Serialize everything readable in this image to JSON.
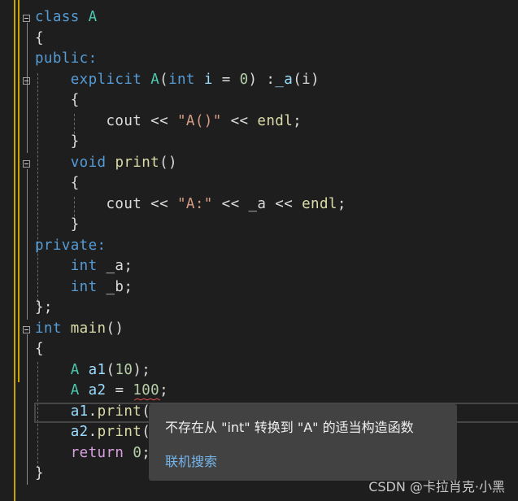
{
  "editor": {
    "lines": [
      [
        [
          "class ",
          "kw"
        ],
        [
          "A",
          "ty"
        ]
      ],
      [
        [
          "{",
          "tx"
        ]
      ],
      [
        [
          "public:",
          "kw"
        ]
      ],
      [
        [
          "    ",
          "tx"
        ],
        [
          "explicit ",
          "kw"
        ],
        [
          "A",
          "ty"
        ],
        [
          "(",
          "tx"
        ],
        [
          "int ",
          "kw"
        ],
        [
          "i ",
          "va"
        ],
        [
          "= ",
          "tx"
        ],
        [
          "0",
          "nu"
        ],
        [
          ") :",
          "tx"
        ],
        [
          "_a",
          "va"
        ],
        [
          "(i)",
          "tx"
        ]
      ],
      [
        [
          "    {",
          "tx"
        ]
      ],
      [
        [
          "        cout << ",
          "tx"
        ],
        [
          "\"A()\"",
          "st"
        ],
        [
          " << ",
          "tx"
        ],
        [
          "endl",
          "fn"
        ],
        [
          ";",
          "tx"
        ]
      ],
      [
        [
          "    }",
          "tx"
        ]
      ],
      [
        [
          "    ",
          "tx"
        ],
        [
          "void ",
          "kw"
        ],
        [
          "print",
          "fn"
        ],
        [
          "()",
          "tx"
        ]
      ],
      [
        [
          "    {",
          "tx"
        ]
      ],
      [
        [
          "        cout << ",
          "tx"
        ],
        [
          "\"A:\"",
          "st"
        ],
        [
          " << _a << ",
          "tx"
        ],
        [
          "endl",
          "fn"
        ],
        [
          ";",
          "tx"
        ]
      ],
      [
        [
          "    }",
          "tx"
        ]
      ],
      [
        [
          "private:",
          "kw"
        ]
      ],
      [
        [
          "    ",
          "tx"
        ],
        [
          "int ",
          "kw"
        ],
        [
          "_a;",
          "tx"
        ]
      ],
      [
        [
          "    ",
          "tx"
        ],
        [
          "int ",
          "kw"
        ],
        [
          "_b;",
          "tx"
        ]
      ],
      [
        [
          "};",
          "tx"
        ]
      ],
      [
        [
          "int ",
          "kw"
        ],
        [
          "main",
          "fn"
        ],
        [
          "()",
          "tx"
        ]
      ],
      [
        [
          "{",
          "tx"
        ]
      ],
      [
        [
          "    ",
          "tx"
        ],
        [
          "A ",
          "ty"
        ],
        [
          "a1",
          "va"
        ],
        [
          "(",
          "tx"
        ],
        [
          "10",
          "nu"
        ],
        [
          ");",
          "tx"
        ]
      ],
      [
        [
          "    ",
          "tx"
        ],
        [
          "A ",
          "ty"
        ],
        [
          "a2 ",
          "va"
        ],
        [
          "= ",
          "tx"
        ],
        [
          "100",
          "nu"
        ],
        [
          ";",
          "tx"
        ]
      ],
      [
        [
          "    ",
          "tx"
        ],
        [
          "a1",
          "va"
        ],
        [
          ".",
          "tx"
        ],
        [
          "print",
          "fn"
        ],
        [
          "(",
          "tx"
        ]
      ],
      [
        [
          "    ",
          "tx"
        ],
        [
          "a2",
          "va"
        ],
        [
          ".",
          "tx"
        ],
        [
          "print",
          "fn"
        ],
        [
          "(",
          "tx"
        ]
      ],
      [
        [
          "    ",
          "tx"
        ],
        [
          "return ",
          "rt"
        ],
        [
          "0",
          "nu"
        ],
        [
          ";",
          "tx"
        ]
      ],
      [
        [
          "}",
          "tx"
        ]
      ]
    ]
  },
  "tooltip": {
    "message": "不存在从 \"int\" 转换到 \"A\" 的适当构造函数",
    "link": "联机搜索"
  },
  "watermark": "CSDN @卡拉肖克·小黑",
  "colors": {
    "background": "#1e1e1e",
    "keyword": "#569cd6",
    "type": "#4ec9b0",
    "string": "#d69d85",
    "number": "#b5cea8",
    "function": "#dcdcaa",
    "error_squiggle": "#e05050",
    "link": "#75b4ea"
  }
}
